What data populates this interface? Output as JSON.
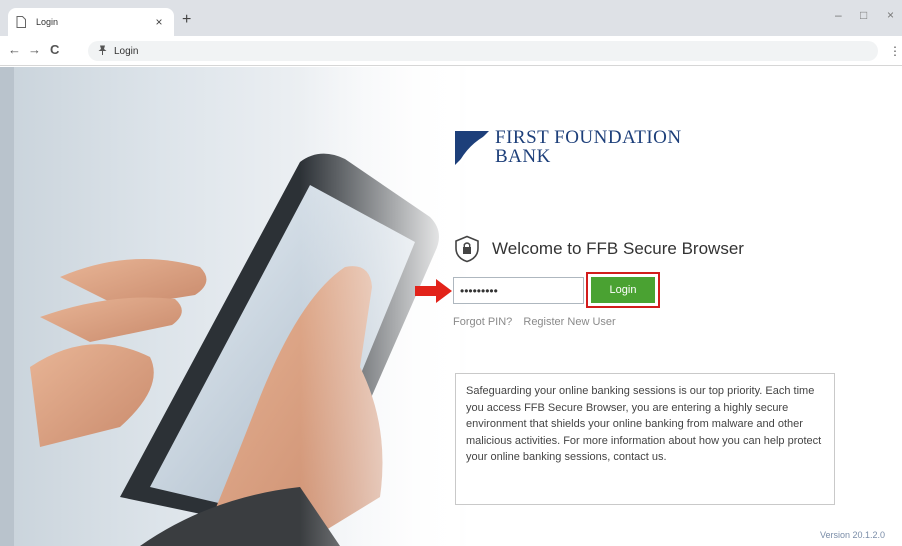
{
  "browser": {
    "tab_title": "Login",
    "tab_close": "×",
    "new_tab": "+",
    "window_controls": {
      "minimize": "–",
      "maximize": "□",
      "close": "×"
    },
    "nav": {
      "back": "←",
      "forward": "→",
      "reload": "C"
    },
    "address": "Login",
    "menu": "⋮"
  },
  "logo": {
    "line1": "FIRST FOUNDATION",
    "line2": "BANK",
    "color": "#1d3f7a"
  },
  "welcome": "Welcome to FFB Secure Browser",
  "pin_input": {
    "value": "•••••••••"
  },
  "login_label": "Login",
  "links": {
    "forgot": "Forgot PIN?",
    "register": "Register New User"
  },
  "info_text": "Safeguarding your online banking sessions is our top priority. Each time you access FFB Secure Browser, you are entering a highly secure environment that shields your online banking from malware and other malicious activities. For more information about how you can help protect your online banking sessions, contact us.",
  "version": "Version 20.1.2.0",
  "colors": {
    "login_green": "#4aa232",
    "highlight_red": "#d21c1c",
    "arrow_red": "#e2231a"
  }
}
